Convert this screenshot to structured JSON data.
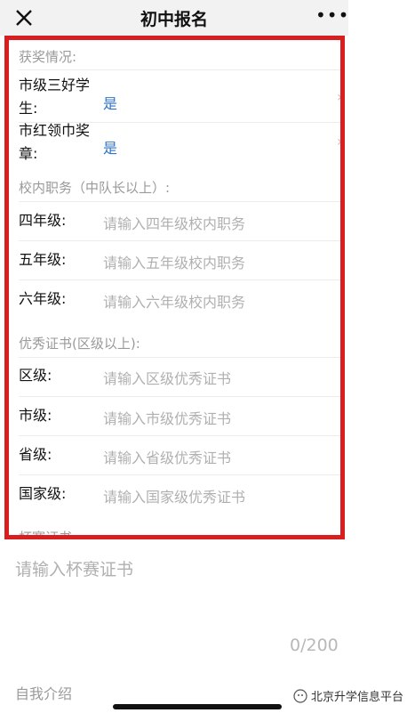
{
  "header": {
    "title": "初中报名",
    "more_label": "•••"
  },
  "awards": {
    "section_title": "获奖情况:",
    "items": [
      {
        "label_line1": "市级三好学",
        "label_line2": "生:",
        "value": "是"
      },
      {
        "label_line1": "市红领巾奖",
        "label_line2": "章:",
        "value": "是"
      }
    ]
  },
  "positions": {
    "section_title": "校内职务（中队长以上）:",
    "rows": [
      {
        "label": "四年级:",
        "placeholder": "请输入四年级校内职务"
      },
      {
        "label": "五年级:",
        "placeholder": "请输入五年级校内职务"
      },
      {
        "label": "六年级:",
        "placeholder": "请输入六年级校内职务"
      }
    ]
  },
  "certificates": {
    "section_title": "优秀证书(区级以上):",
    "rows": [
      {
        "label": "区级:",
        "placeholder": "请输入区级优秀证书"
      },
      {
        "label": "市级:",
        "placeholder": "请输入市级优秀证书"
      },
      {
        "label": "省级:",
        "placeholder": "请输入省级优秀证书"
      },
      {
        "label": "国家级:",
        "placeholder": "请输入国家级优秀证书"
      }
    ]
  },
  "cup": {
    "section_title": "杯赛证书",
    "placeholder": "请输入杯赛证书",
    "counter": "0/200"
  },
  "intro": {
    "section_title": "自我介绍"
  },
  "watermark": {
    "text": "北京升学信息平台"
  },
  "colors": {
    "frame": "#d81e1e",
    "link": "#2f74c6",
    "placeholder": "#b0b0b0"
  }
}
